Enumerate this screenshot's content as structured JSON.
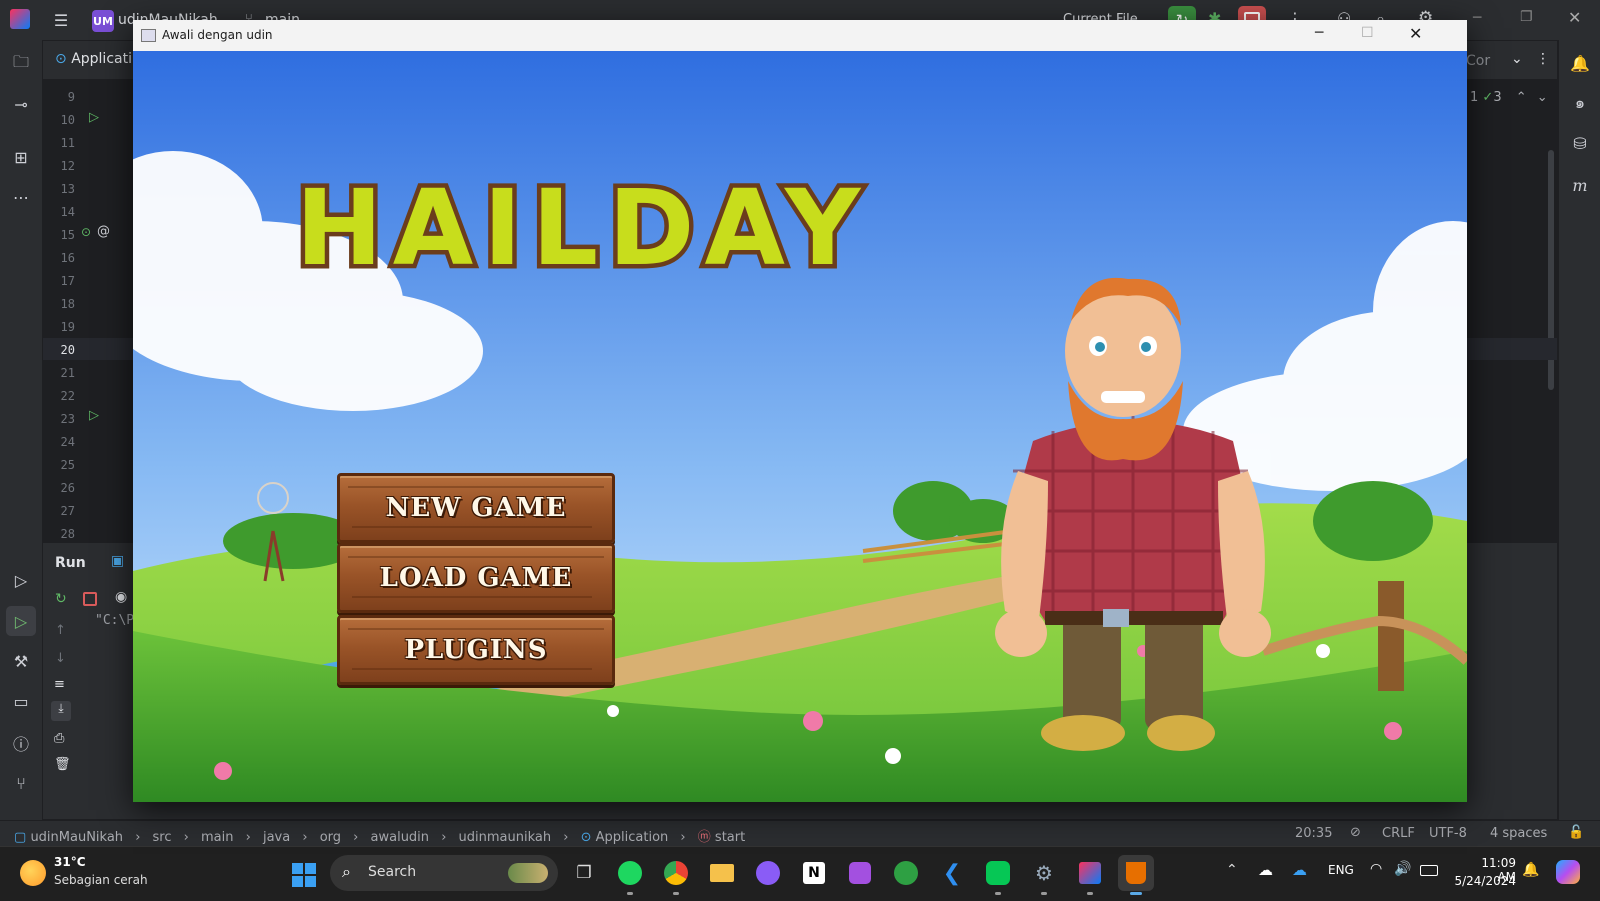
{
  "ide": {
    "project_badge": "UM",
    "project_name": "udinMauNikah",
    "branch": "main",
    "run_config": "Current File",
    "editor_tab": "Applicati",
    "right_tab": "Cor",
    "inspections": {
      "warnings": "1",
      "checks": "3"
    },
    "line_numbers": [
      "9",
      "10",
      "11",
      "12",
      "13",
      "14",
      "15",
      "16",
      "17",
      "18",
      "19",
      "20",
      "21",
      "22",
      "23",
      "24",
      "25",
      "26",
      "27",
      "28"
    ],
    "current_line": "20",
    "run_panel": {
      "title": "Run",
      "console_text": "\"C:\\P"
    },
    "breadcrumbs": [
      "udinMauNikah",
      "src",
      "main",
      "java",
      "org",
      "awaludin",
      "udinmaunikah",
      "Application",
      "start"
    ],
    "status": {
      "position": "20:35",
      "line_ending": "CRLF",
      "encoding": "UTF-8",
      "indent": "4 spaces"
    }
  },
  "game_window": {
    "title": "Awali dengan udin",
    "logo_text": "HAILDAY",
    "menu": {
      "new_game": "NEW GAME",
      "load_game": "LOAD GAME",
      "plugins": "PLUGINS"
    }
  },
  "taskbar": {
    "weather_temp": "31°C",
    "weather_desc": "Sebagian cerah",
    "search_label": "Search",
    "language": "ENG",
    "time": "11:09 AM",
    "date": "5/24/2024"
  },
  "colors": {
    "logo_fill": "#c8dd1c",
    "logo_outline": "#6b3d1c",
    "wood": "#9a5428",
    "sky_top": "#3d7ee6",
    "grass": "#6cc23a"
  }
}
